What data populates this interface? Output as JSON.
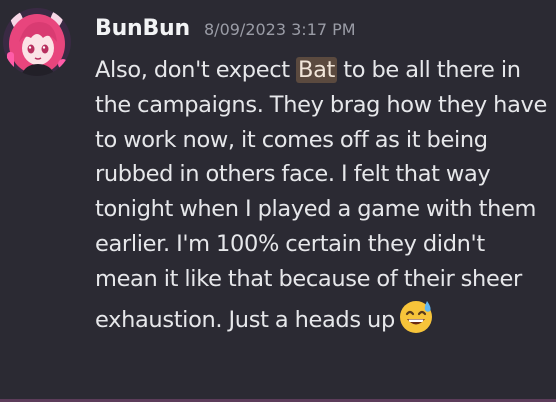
{
  "message": {
    "username": "BunBun",
    "timestamp": "8/09/2023 3:17 PM",
    "text_before_mention": "Also, don't expect ",
    "mention": "Bat",
    "text_after_mention": " to be all there in the campaigns. They brag how they have to work now, it comes off as it being rubbed in others face. I felt that way tonight when I played a game with them earlier. I'm 100% certain they didn't mean it like that because of their sheer exhaustion.  Just a heads up",
    "emoji": "sweat-smile-emoji"
  },
  "colors": {
    "background": "#2b2a33",
    "username": "#f2f3f5",
    "timestamp": "#9a9ca6",
    "text": "#e6e7ea",
    "mention_bg": "#5b4a3f",
    "avatar_hair": "#e8457d",
    "emoji_face": "#f7c43a"
  }
}
